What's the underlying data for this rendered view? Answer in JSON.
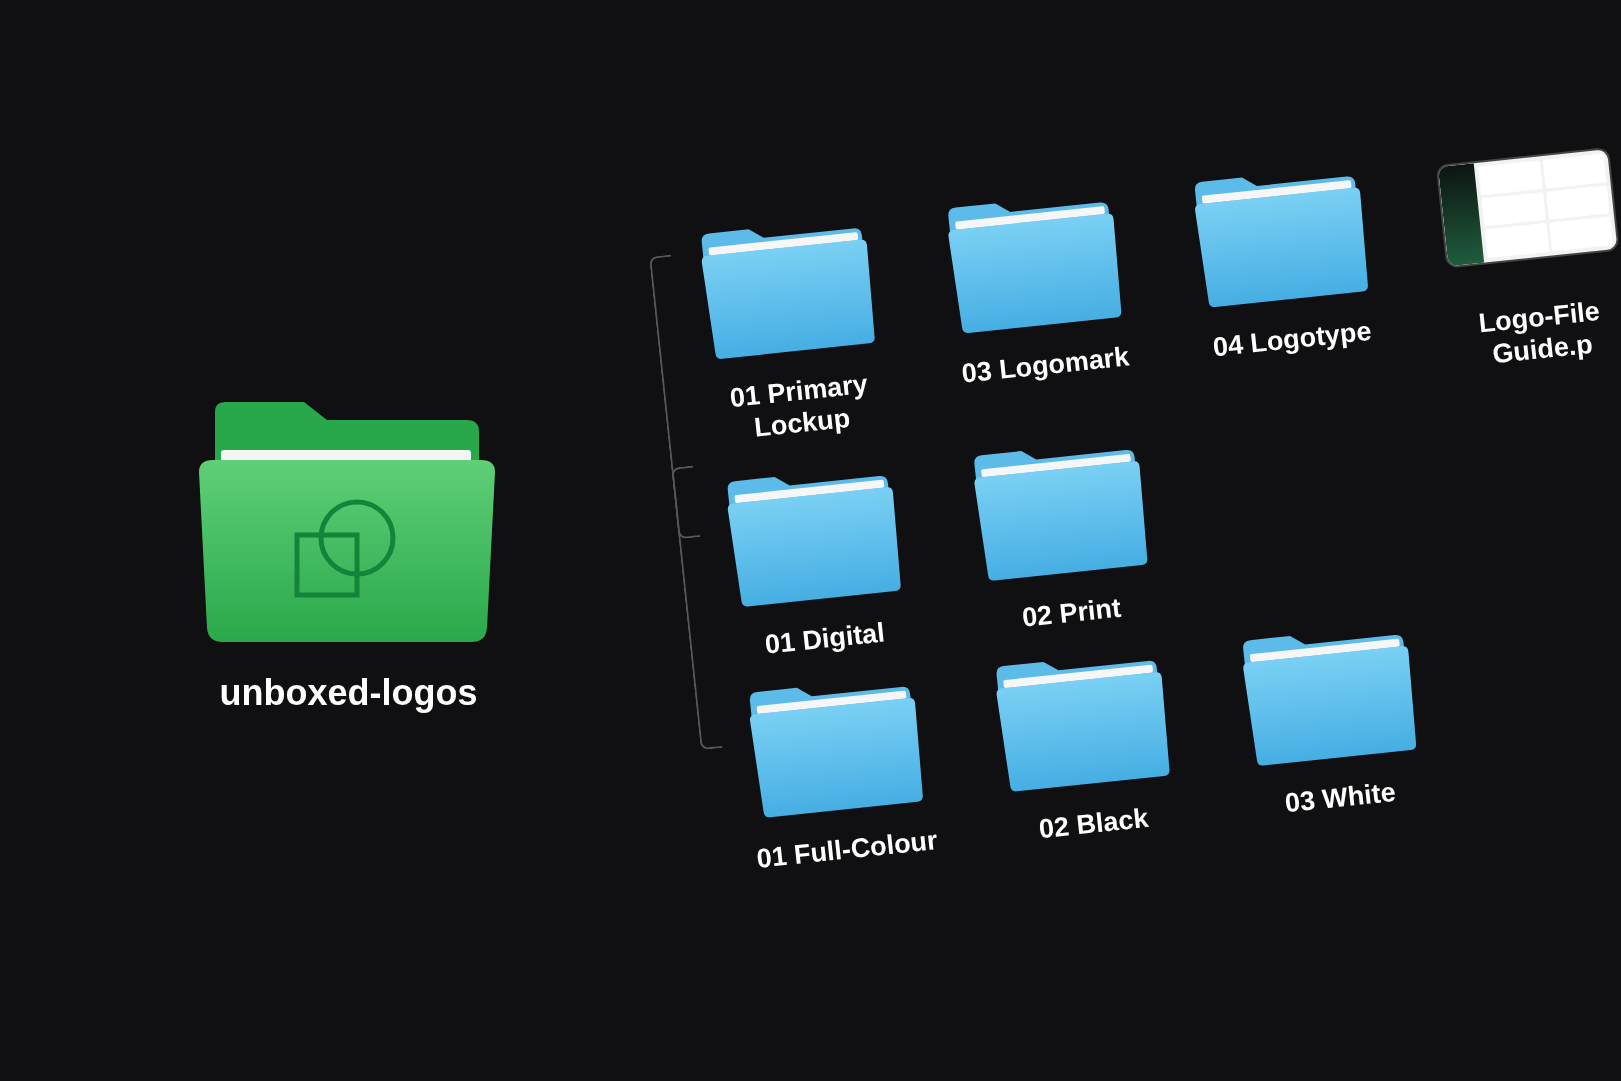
{
  "root": {
    "name": "unboxed-logos",
    "kind": "folder",
    "children": [
      {
        "name": "01 Primary Lockup",
        "kind": "folder",
        "children": [
          {
            "name": "01 Digital",
            "kind": "folder",
            "children": [
              {
                "name": "01 Full-Colour",
                "kind": "folder"
              },
              {
                "name": "02 Black",
                "kind": "folder"
              },
              {
                "name": "03 White",
                "kind": "folder"
              }
            ]
          },
          {
            "name": "02 Print",
            "kind": "folder"
          }
        ]
      },
      {
        "name": "03 Logomark",
        "kind": "folder"
      },
      {
        "name": "04 Logotype",
        "kind": "folder"
      },
      {
        "name": "Logo-File Guide.p",
        "kind": "document"
      }
    ]
  }
}
